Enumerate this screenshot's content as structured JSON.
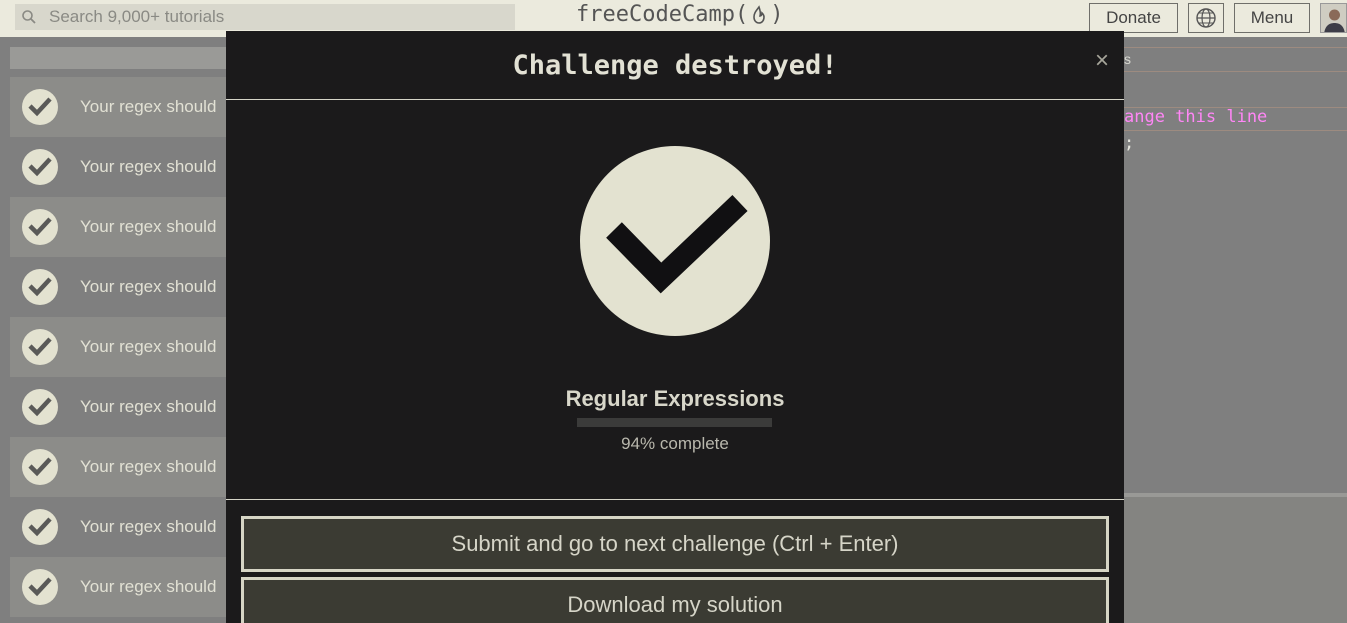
{
  "nav": {
    "search_placeholder": "Search 9,000+ tutorials",
    "logo_text": "freeCodeCamp(",
    "logo_close": ")",
    "donate_label": "Donate",
    "menu_label": "Menu",
    "globe_icon": "globe-icon",
    "search_icon": "search-icon",
    "avatar_icon": "user-avatar"
  },
  "tests": {
    "items": [
      {
        "text": "Your regex should"
      },
      {
        "text": "Your regex should"
      },
      {
        "text": "Your regex should"
      },
      {
        "text": "Your regex should"
      },
      {
        "text": "Your regex should"
      },
      {
        "text": "Your regex should"
      },
      {
        "text": "Your regex should"
      },
      {
        "text": "Your regex should"
      },
      {
        "text": "Your regex should"
      }
    ]
  },
  "editor": {
    "tab_fragment": "s",
    "comment_fragment": "ange this line",
    "semicolon": ";"
  },
  "modal": {
    "title": "Challenge destroyed!",
    "close_label": "×",
    "cert_title": "Regular Expressions",
    "progress_percent": 94,
    "progress_label": "94% complete",
    "submit_label": "Submit and go to next challenge (Ctrl + Enter)",
    "download_label": "Download my solution"
  },
  "colors": {
    "modal_bg": "#1b1a1b",
    "accent_cream": "#e3e2d0",
    "button_bg": "#3b3b33",
    "comment_pink": "#ff86f6"
  }
}
